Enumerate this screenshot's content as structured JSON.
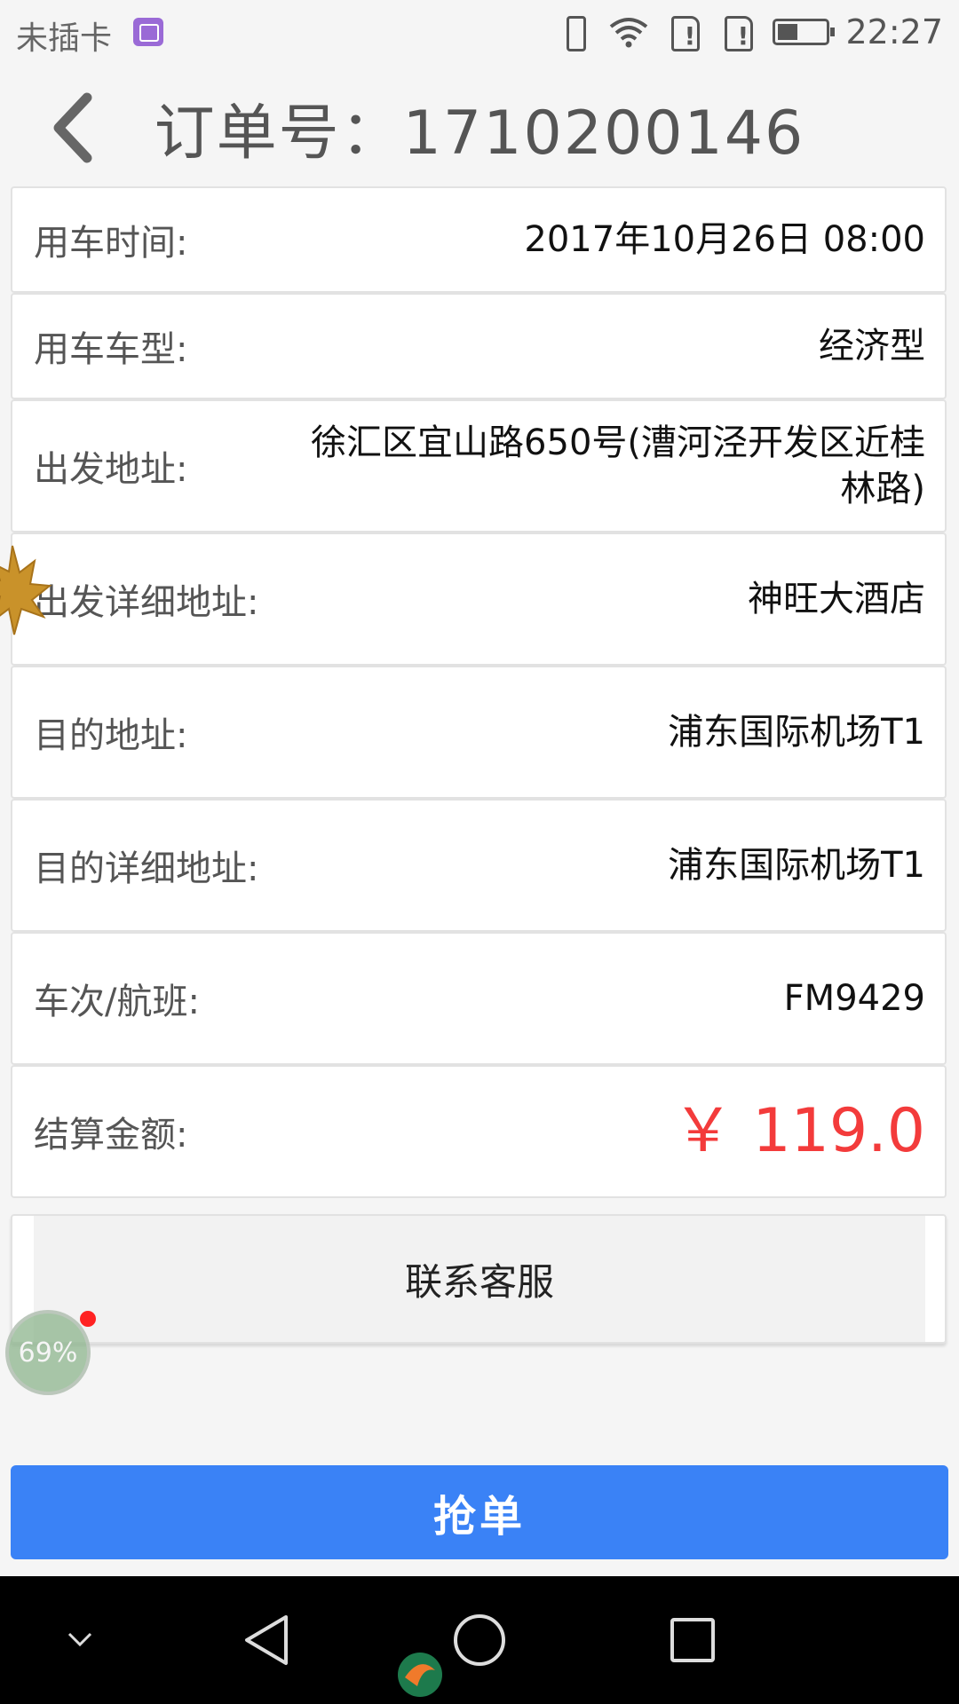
{
  "status_bar": {
    "carrier": "未插卡",
    "time": "22:27",
    "icons": [
      "gallery-icon",
      "vibrate-icon",
      "wifi-icon",
      "sim-alert-icon",
      "sim-alert-icon",
      "battery-icon"
    ]
  },
  "header": {
    "title": "订单号：1710200146",
    "back_icon": "back-chevron-icon"
  },
  "order_rows": [
    {
      "label": "用车时间:",
      "value": "2017年10月26日 08:00"
    },
    {
      "label": "用车车型:",
      "value": "经济型"
    },
    {
      "label": "出发地址:",
      "value": "徐汇区宜山路650号(漕河泾开发区近桂林路)"
    },
    {
      "label": "出发详细地址:",
      "value": "神旺大酒店"
    },
    {
      "label": "目的地址:",
      "value": "浦东国际机场T1"
    },
    {
      "label": "目的详细地址:",
      "value": "浦东国际机场T1"
    },
    {
      "label": "车次/航班:",
      "value": "FM9429"
    },
    {
      "label": "结算金额:",
      "value": "￥ 119.0"
    }
  ],
  "contact_label": "联系客服",
  "grab_order_label": "抢单",
  "floating_widget": {
    "percent": "69%"
  },
  "colors": {
    "accent_blue": "#3a82f6",
    "money_red": "#f33b3b",
    "background": "#f5f5f5"
  },
  "nav_bar": {
    "icons": [
      "chevron-down-icon",
      "back-triangle-icon",
      "home-circle-icon",
      "recents-square-icon"
    ]
  }
}
